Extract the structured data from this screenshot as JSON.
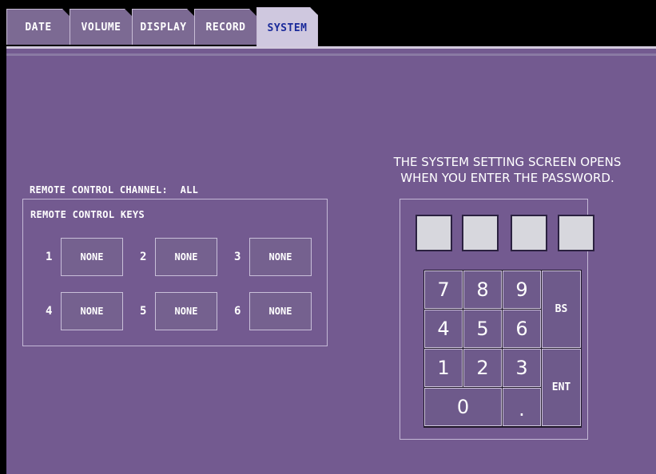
{
  "tabs": [
    {
      "label": "DATE"
    },
    {
      "label": "VOLUME"
    },
    {
      "label": "DISPLAY"
    },
    {
      "label": "RECORD"
    },
    {
      "label": "SYSTEM",
      "active": true
    }
  ],
  "remote": {
    "channel_label": "REMOTE CONTROL CHANNEL:",
    "channel_value": "ALL",
    "keys_label": "REMOTE CONTROL KEYS",
    "keys": [
      {
        "num": "1",
        "value": "NONE"
      },
      {
        "num": "2",
        "value": "NONE"
      },
      {
        "num": "3",
        "value": "NONE"
      },
      {
        "num": "4",
        "value": "NONE"
      },
      {
        "num": "5",
        "value": "NONE"
      },
      {
        "num": "6",
        "value": "NONE"
      }
    ]
  },
  "password": {
    "message_line1": "THE SYSTEM SETTING SCREEN OPENS",
    "message_line2": "WHEN YOU ENTER THE PASSWORD.",
    "keypad": {
      "k7": "7",
      "k8": "8",
      "k9": "9",
      "k4": "4",
      "k5": "5",
      "k6": "6",
      "k1": "1",
      "k2": "2",
      "k3": "3",
      "k0": "0",
      "dot": ".",
      "bs": "BS",
      "ent": "ENT"
    }
  },
  "colors": {
    "panel": "#735a90",
    "tab": "#7c6a93",
    "tab_active": "#cfc8df",
    "tab_active_text": "#1a2a9a"
  }
}
